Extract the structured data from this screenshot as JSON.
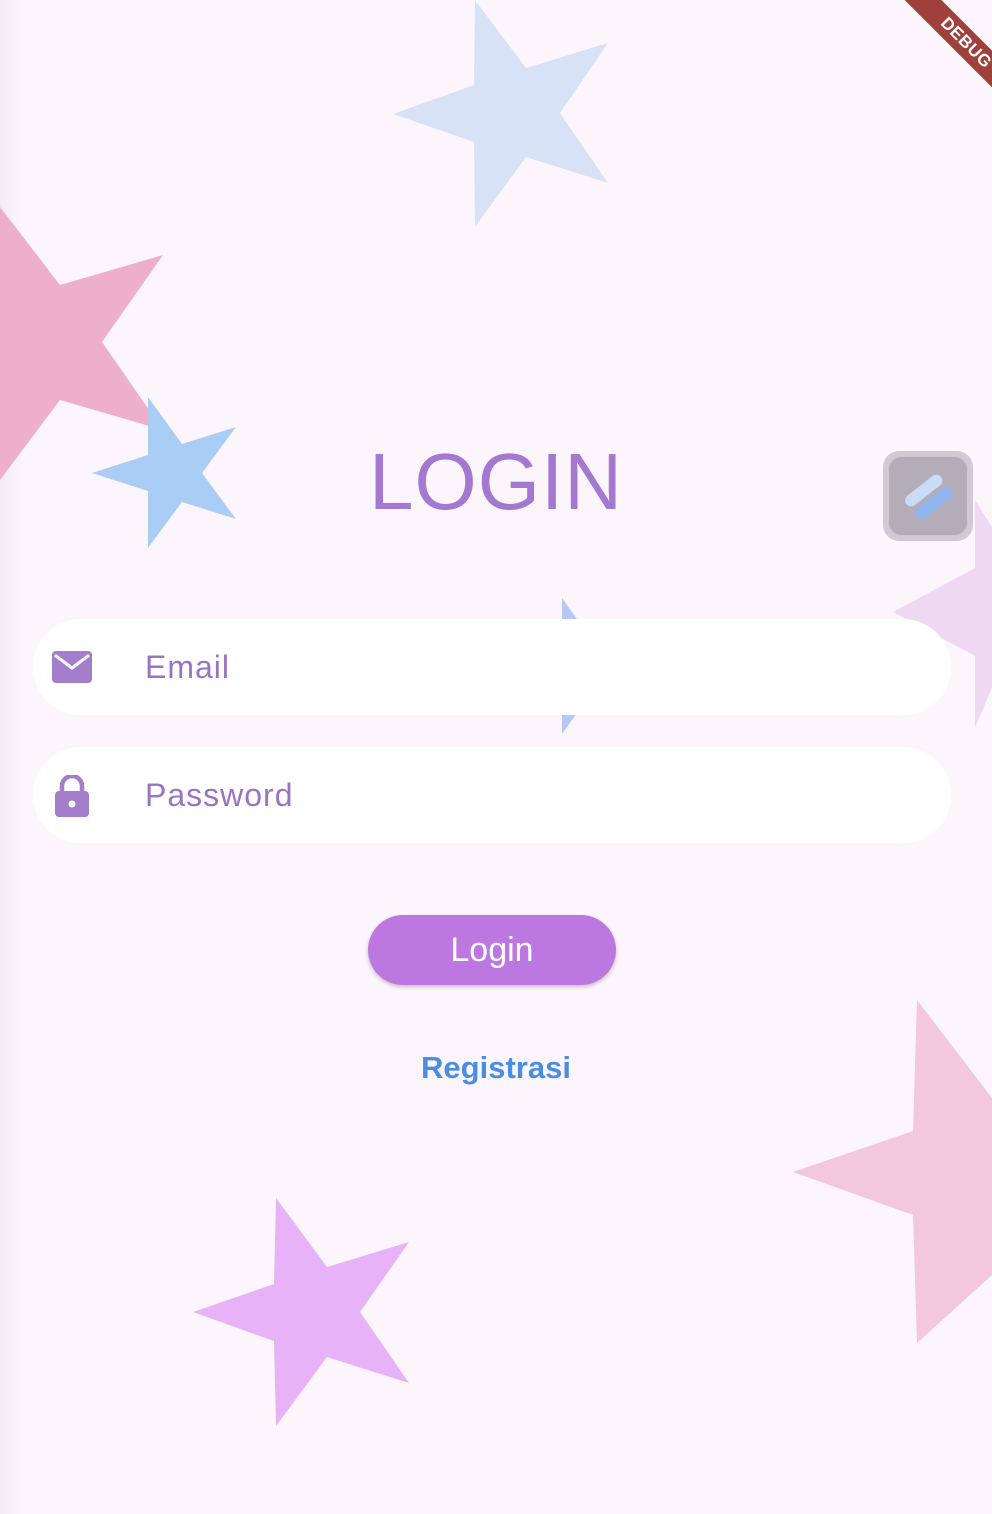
{
  "title": "LOGIN",
  "email_field": {
    "placeholder": "Email",
    "icon": "envelope-icon"
  },
  "password_field": {
    "placeholder": "Password",
    "icon": "lock-icon"
  },
  "login_button_label": "Login",
  "register_link_label": "Registrasi",
  "debug_banner_label": "DEBUG",
  "floating_tool_icon": "flash-tool-icon",
  "colors": {
    "background": "#fcf6fc",
    "title": "#a477d1",
    "icon": "#a47ecb",
    "placeholder": "#9a74c4",
    "button": "#bc78e0",
    "link": "#4a8de4",
    "debug": "#a0403a"
  },
  "decorations": [
    {
      "shape": "star",
      "color": "#d8e2f6"
    },
    {
      "shape": "star",
      "color": "#eeafc8"
    },
    {
      "shape": "star",
      "color": "#a9cdf5"
    },
    {
      "shape": "star",
      "color": "#b6c8f8"
    },
    {
      "shape": "star",
      "color": "#eed8f2"
    },
    {
      "shape": "star",
      "color": "#f2c8da"
    },
    {
      "shape": "star",
      "color": "#e7b2f7"
    }
  ]
}
